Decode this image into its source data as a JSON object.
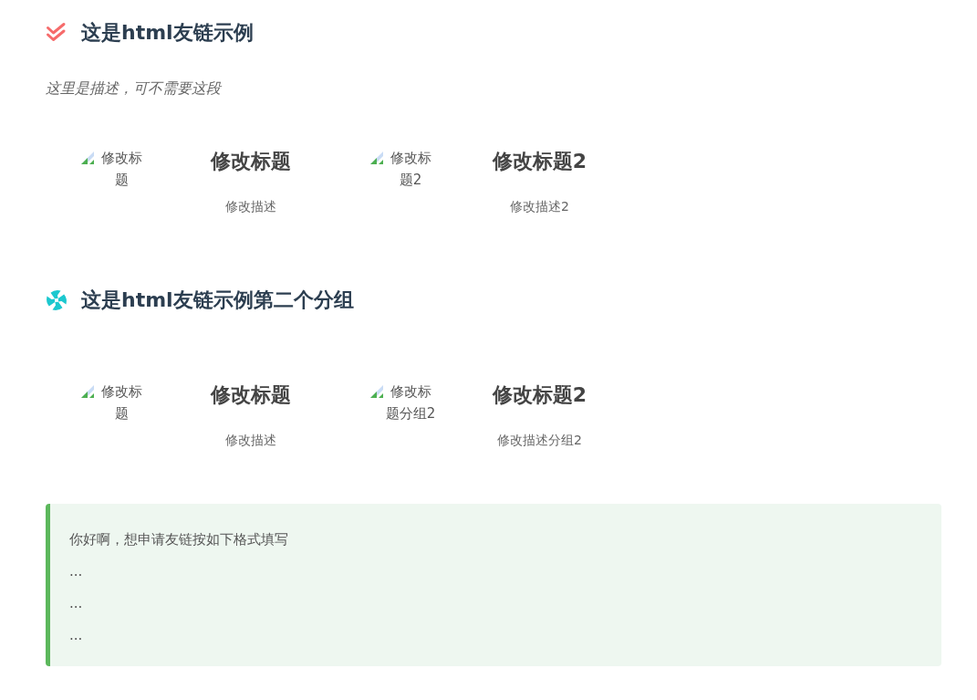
{
  "groups": [
    {
      "title": "这是html友链示例",
      "description": "这里是描述，可不需要这段",
      "links": [
        {
          "image_alt": "修改标题",
          "title": "修改标题",
          "description": "修改描述"
        },
        {
          "image_alt": "修改标题2",
          "title": "修改标题2",
          "description": "修改描述2"
        }
      ]
    },
    {
      "title": "这是html友链示例第二个分组",
      "links": [
        {
          "image_alt": "修改标题",
          "title": "修改标题",
          "description": "修改描述"
        },
        {
          "image_alt": "修改标题分组2",
          "title": "修改标题2",
          "description": "修改描述分组2"
        }
      ]
    }
  ],
  "notice": {
    "lines": [
      "你好啊，想申请友链按如下格式填写",
      "...",
      "...",
      "..."
    ]
  }
}
